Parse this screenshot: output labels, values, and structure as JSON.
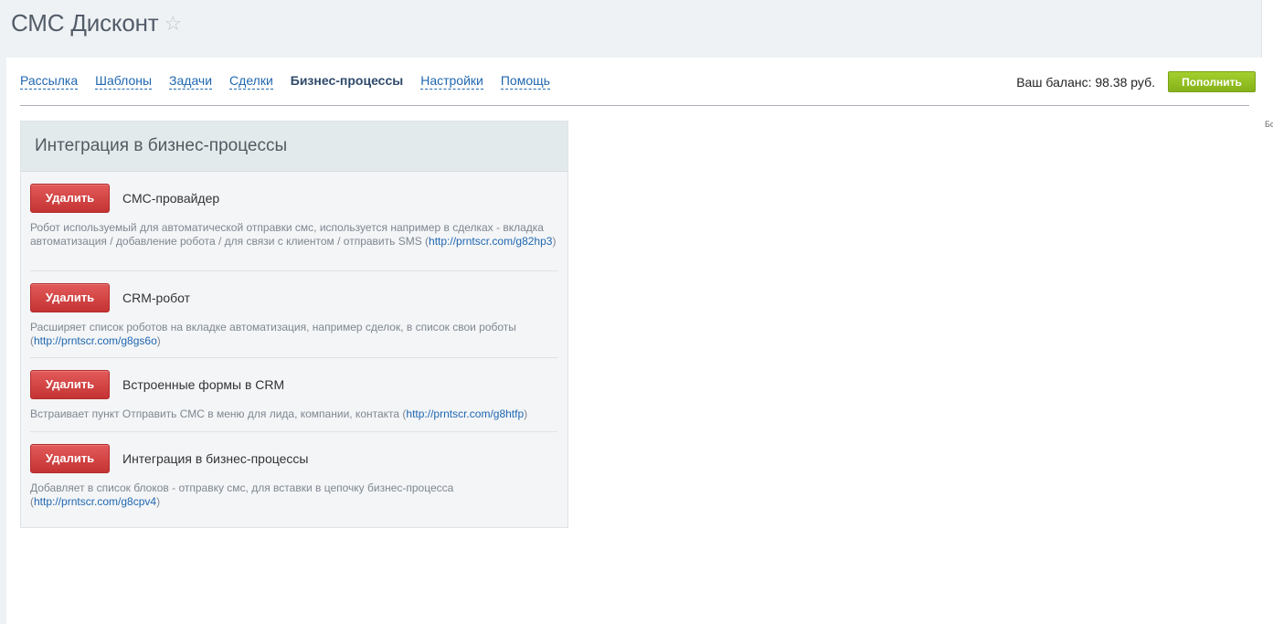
{
  "page": {
    "title": "СМС Дисконт",
    "star_icon": "star-icon",
    "right_strip_text": "Бс"
  },
  "nav": {
    "items": [
      {
        "label": "Рассылка",
        "active": false
      },
      {
        "label": "Шаблоны",
        "active": false
      },
      {
        "label": "Задачи",
        "active": false
      },
      {
        "label": "Сделки",
        "active": false
      },
      {
        "label": "Бизнес-процессы",
        "active": true
      },
      {
        "label": "Настройки",
        "active": false
      },
      {
        "label": "Помощь",
        "active": false
      }
    ]
  },
  "balance": {
    "text": "Ваш баланс: 98.38 руб.",
    "topup_label": "Пополнить",
    "topup_color": "#8dbb1e"
  },
  "panel": {
    "title": "Интеграция в бизнес-процессы",
    "delete_color": "#d64545",
    "items": [
      {
        "button": "Удалить",
        "name": "СМС-провайдер",
        "desc_before": "Робот используемый для автоматической отправки смс, используется например в сделках - вкладка автоматизация / добавление робота / для связи с клиентом / отправить SMS (",
        "link": "http://prntscr.com/g82hp3",
        "desc_after": ")"
      },
      {
        "button": "Удалить",
        "name": "CRM-робот",
        "desc_before": "Расширяет список роботов на вкладке автоматизация, например сделок, в список свои роботы (",
        "link": "http://prntscr.com/g8gs6o",
        "desc_after": ")"
      },
      {
        "button": "Удалить",
        "name": "Встроенные формы в CRM",
        "desc_before": "Встраивает пункт Отправить СМС в меню для лида, компании, контакта (",
        "link": "http://prntscr.com/g8htfp",
        "desc_after": ")"
      },
      {
        "button": "Удалить",
        "name": "Интеграция в бизнес-процессы",
        "desc_before": "Добавляет в список блоков - отправку смс, для вставки в цепочку бизнес-процесса (",
        "link": "http://prntscr.com/g8cpv4",
        "desc_after": ")"
      }
    ]
  }
}
